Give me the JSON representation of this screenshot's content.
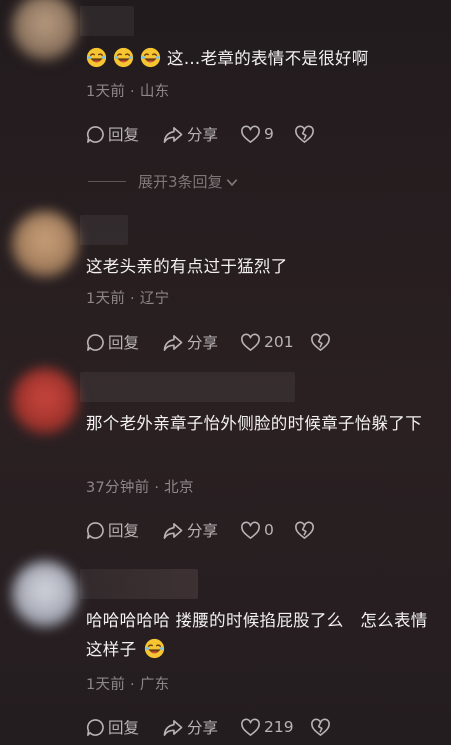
{
  "comments": [
    {
      "text": "这…老章的表情不是很好啊",
      "emoji_prefix_count": 3,
      "meta": "1天前 · 山东",
      "reply_label": "回复",
      "share_label": "分享",
      "like_count": "9"
    },
    {
      "text": "这老头亲的有点过于猛烈了",
      "meta": "1天前 · 辽宁",
      "reply_label": "回复",
      "share_label": "分享",
      "like_count": "201"
    },
    {
      "text": "那个老外亲章子怡外侧脸的时候章子怡躲了下",
      "meta": "37分钟前 · 北京",
      "reply_label": "回复",
      "share_label": "分享",
      "like_count": "0"
    },
    {
      "text": "哈哈哈哈哈 搂腰的时候掐屁股了么　怎么表情这样子",
      "emoji_suffix": "rofl-emoji",
      "meta": "1天前 · 广东",
      "reply_label": "回复",
      "share_label": "分享",
      "like_count": "219"
    }
  ],
  "expand_replies": "展开3条回复",
  "icons": {
    "emoji": "rofl-emoji",
    "reply": "speech-bubble-icon",
    "share": "share-arrow-icon",
    "like": "heart-outline-icon",
    "dislike": "broken-heart-icon",
    "expand": "chevron-down-icon"
  },
  "colors": {
    "background": "#221b1d",
    "text": "#f3f1f2",
    "meta": "#8d8789",
    "actions": "#b8b3b5",
    "emoji_yellow": "#f7c531"
  }
}
